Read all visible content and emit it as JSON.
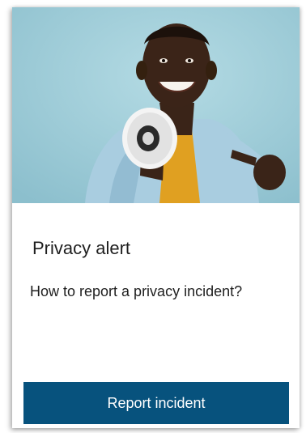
{
  "card": {
    "title": "Privacy alert",
    "question": "How to report a privacy incident?",
    "button_label": "Report incident"
  },
  "hero": {
    "icon": "megaphone-icon",
    "background_color": "#9ac9d6"
  },
  "colors": {
    "button_bg": "#07527d",
    "button_text": "#ffffff",
    "text": "#1f1f1f"
  }
}
